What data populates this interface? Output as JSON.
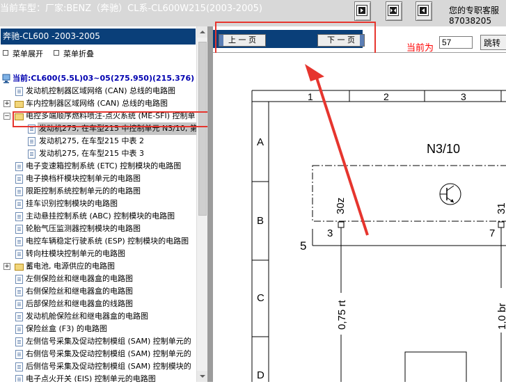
{
  "header": {
    "title": "当前车型：厂家:BENZ（奔驰）CL系-CL600W215(2003-2005)",
    "contact_line1": "您的专职客服",
    "contact_line2": "87038205",
    "toolbar_icons": [
      "split-view-left-icon",
      "split-view-both-icon",
      "split-view-right-icon"
    ]
  },
  "sidebar": {
    "model_title": "奔驰-CL600 -2003-2005",
    "expand_label": "菜单展开",
    "collapse_label": "菜单折叠",
    "items": [
      {
        "label": "当前:CL600(5.5L)03~05(275.950)(215.376)",
        "type": "current"
      },
      {
        "label": "发动机控制器区域网络 (CAN) 总线的电路图",
        "type": "doc"
      },
      {
        "label": "车内控制器区域网络 (CAN) 总线的电路图",
        "type": "folder"
      },
      {
        "label": "电控多端顺序燃料喷注-点火系统 (ME-SFI) 控制单",
        "type": "folder-open"
      },
      {
        "label": "发动机275, 在车型215 中控制单元 N3/10, 第",
        "type": "doc-selected"
      },
      {
        "label": "发动机275, 在车型215 中表 2",
        "type": "doc-child"
      },
      {
        "label": "发动机275, 在车型215 中表 3",
        "type": "doc-child"
      },
      {
        "label": "电子变速箱控制系统 (ETC) 控制模块的电路图",
        "type": "doc"
      },
      {
        "label": "电子换档杆模块控制单元的电路图",
        "type": "doc"
      },
      {
        "label": "限距控制系统控制单元的的电路图",
        "type": "doc"
      },
      {
        "label": "挂车识别控制模块的电路图",
        "type": "doc"
      },
      {
        "label": "主动悬挂控制系统 (ABC) 控制模块的电路图",
        "type": "doc"
      },
      {
        "label": "轮胎气压监测器控制模块的电路图",
        "type": "doc"
      },
      {
        "label": "电控车辆稳定行驶系统 (ESP) 控制模块的电路图",
        "type": "doc"
      },
      {
        "label": "转向柱模块控制单元的电路图",
        "type": "doc"
      },
      {
        "label": "蓄电池, 电源供应的电路图",
        "type": "folder"
      },
      {
        "label": "左侧保险丝和继电器盒的电路图",
        "type": "doc"
      },
      {
        "label": "右侧保险丝和继电器盒的电路图",
        "type": "doc"
      },
      {
        "label": "后部保险丝和继电器盒的线路图",
        "type": "doc"
      },
      {
        "label": "发动机舱保险丝和继电器盒的电路图",
        "type": "doc"
      },
      {
        "label": "保险丝盒 (F3) 的电路图",
        "type": "doc"
      },
      {
        "label": "左侧信号采集及促动控制模组 (SAM) 控制单元的",
        "type": "doc"
      },
      {
        "label": "右侧信号采集及促动控制模组 (SAM) 控制单元的",
        "type": "doc"
      },
      {
        "label": "后侧信号采集及促动控制模组 (SAM) 控制模块的",
        "type": "doc"
      },
      {
        "label": "电子点火开关 (EIS) 控制单元的电路图",
        "type": "doc"
      }
    ]
  },
  "nav": {
    "prev_label": "上 一 页",
    "next_label": "下 一 页",
    "current_label": "当前为",
    "current_value": "57",
    "jump_label": "跳转"
  },
  "diagram": {
    "col_labels": [
      "1",
      "2",
      "3"
    ],
    "row_labels": [
      "A",
      "B",
      "C",
      "D"
    ],
    "component": "N3/10",
    "pin_30z": "30z",
    "pin_31": "31",
    "pin_3": "3",
    "pin_7": "7",
    "label_5": "5",
    "wire_075rt": "0,75 rt",
    "wire_10br": "1,0 br"
  },
  "colors": {
    "accent_blue": "#0a3f79",
    "annotation_red": "#e6352e",
    "current_label_red": "#ff0000"
  }
}
